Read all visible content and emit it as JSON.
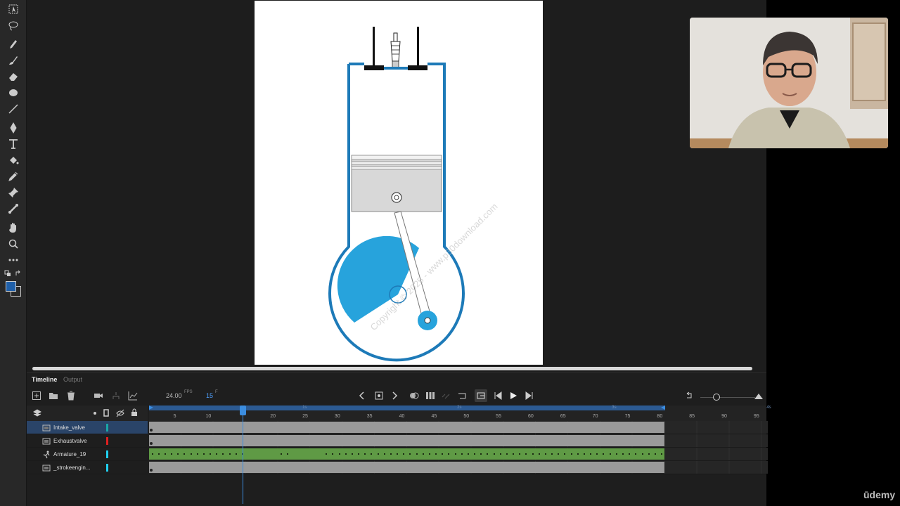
{
  "colors": {
    "accent": "#2a90d8",
    "fill_color_swatch": "#1f5fa8",
    "engine_blue": "#27a3dc",
    "engine_outline": "#1d7ab8",
    "tween_green": "#5f9a45",
    "frame_gray": "#9a9a9a",
    "playhead": "#3b8de0"
  },
  "tools": [
    {
      "icon": "free-transform-icon"
    },
    {
      "icon": "lasso-icon"
    },
    {
      "icon": "paint-brush-icon"
    },
    {
      "icon": "brush-icon"
    },
    {
      "icon": "eraser-icon"
    },
    {
      "icon": "oval-icon"
    },
    {
      "icon": "line-icon"
    },
    {
      "icon": "pen-icon"
    },
    {
      "icon": "text-icon"
    },
    {
      "icon": "paint-bucket-icon"
    },
    {
      "icon": "eyedropper-icon"
    },
    {
      "icon": "pin-icon"
    },
    {
      "icon": "bone-icon"
    },
    {
      "icon": "hand-icon"
    },
    {
      "icon": "zoom-icon"
    },
    {
      "icon": "more-tools-icon"
    }
  ],
  "stage": {
    "watermark": "Copyright © 2025 - www.p30download.com"
  },
  "timeline": {
    "tab_timeline": "Timeline",
    "tab_output": "Output",
    "fps_value": "24.00",
    "fps_unit": "FPS",
    "current_frame": "15",
    "frame_unit": "F",
    "ruler_frames": [
      "5",
      "10",
      "20",
      "25",
      "30",
      "35",
      "40",
      "45",
      "50",
      "55",
      "60",
      "65",
      "70",
      "75",
      "80",
      "85",
      "90",
      "95"
    ],
    "time_marks": [
      "1s",
      "2s",
      "3s",
      "4s"
    ],
    "total_frames": 80,
    "visible_frames": 96,
    "playhead_frame": 15,
    "layers": [
      {
        "name": "Intake_valve",
        "color": "#1aa6a6",
        "selected": true,
        "icon": "layer-icon",
        "type": "frames",
        "keyframes": [
          1
        ]
      },
      {
        "name": "Exhaustvalve",
        "color": "#e02020",
        "selected": false,
        "icon": "layer-icon",
        "type": "frames",
        "keyframes": [
          1
        ]
      },
      {
        "name": "Armature_19",
        "color": "#20d0f0",
        "selected": false,
        "icon": "armature-icon",
        "type": "tween"
      },
      {
        "name": "_strokeengin...",
        "color": "#20d0f0",
        "selected": false,
        "icon": "layer-icon",
        "type": "frames",
        "keyframes": [
          1
        ]
      }
    ]
  },
  "branding": {
    "udemy": "ūdemy"
  }
}
